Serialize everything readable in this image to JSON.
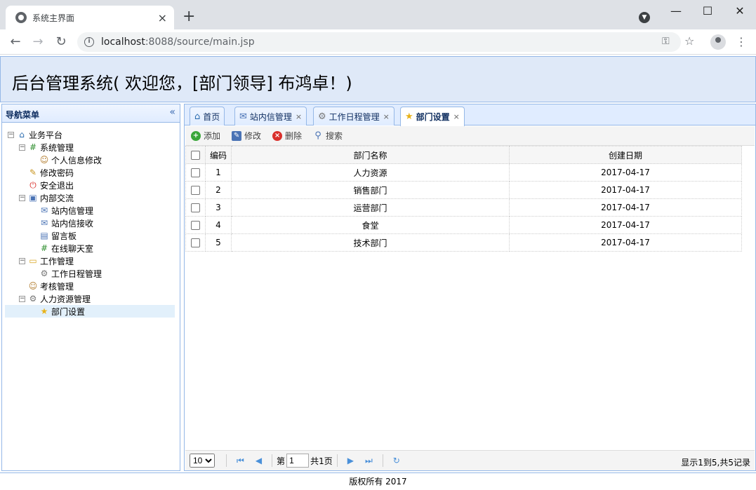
{
  "browser": {
    "tab_title": "系统主界面",
    "tab_close": "×",
    "new_tab": "+",
    "url_host": "localhost",
    "url_rest": ":8088/source/main.jsp",
    "window": {
      "minimize": "—",
      "maximize": "☐",
      "close": "✕"
    }
  },
  "header": {
    "title": "后台管理系统( 欢迎您，[部门领导] 布鸿卓！)"
  },
  "nav": {
    "title": "导航菜单",
    "collapse": "«",
    "tree": [
      {
        "label": "业务平台",
        "icon": "home-icon",
        "expander": "−"
      },
      {
        "label": "系统管理",
        "icon": "green-grid-icon",
        "expander": "−"
      },
      {
        "label": "个人信息修改",
        "icon": "user-edit-icon"
      },
      {
        "label": "修改密码",
        "icon": "key-folder-icon"
      },
      {
        "label": "安全退出",
        "icon": "exit-icon"
      },
      {
        "label": "内部交流",
        "icon": "computer-icon",
        "expander": "−"
      },
      {
        "label": "站内信管理",
        "icon": "mail-icon"
      },
      {
        "label": "站内信接收",
        "icon": "mail-icon"
      },
      {
        "label": "留言板",
        "icon": "book-icon"
      },
      {
        "label": "在线聊天室",
        "icon": "green-grid-icon"
      },
      {
        "label": "工作管理",
        "icon": "folder-icon",
        "expander": "−"
      },
      {
        "label": "工作日程管理",
        "icon": "gear-icon"
      },
      {
        "label": "考核管理",
        "icon": "user-edit-icon"
      },
      {
        "label": "人力资源管理",
        "icon": "gear-icon",
        "expander": "−"
      },
      {
        "label": "部门设置",
        "icon": "star-icon",
        "selected": true
      }
    ]
  },
  "tabs": [
    {
      "label": "首页",
      "icon": "home-icon",
      "closable": false
    },
    {
      "label": "站内信管理",
      "icon": "mail-icon",
      "closable": true
    },
    {
      "label": "工作日程管理",
      "icon": "gear-icon",
      "closable": true
    },
    {
      "label": "部门设置",
      "icon": "star-icon",
      "closable": true,
      "active": true
    }
  ],
  "tab_close": "×",
  "toolbar": {
    "add": "添加",
    "edit": "修改",
    "delete": "删除",
    "search": "搜索"
  },
  "grid": {
    "columns": [
      "编码",
      "部门名称",
      "创建日期"
    ],
    "rows": [
      {
        "id": "1",
        "name": "人力资源",
        "date": "2017-04-17"
      },
      {
        "id": "2",
        "name": "销售部门",
        "date": "2017-04-17"
      },
      {
        "id": "3",
        "name": "运营部门",
        "date": "2017-04-17"
      },
      {
        "id": "4",
        "name": "食堂",
        "date": "2017-04-17"
      },
      {
        "id": "5",
        "name": "技术部门",
        "date": "2017-04-17"
      }
    ]
  },
  "pager": {
    "page_size": "10",
    "page_label": "第",
    "page_value": "1",
    "total_pages": "共1页",
    "info": "显示1到5,共5记录"
  },
  "footer": {
    "text": "版权所有  2017"
  }
}
